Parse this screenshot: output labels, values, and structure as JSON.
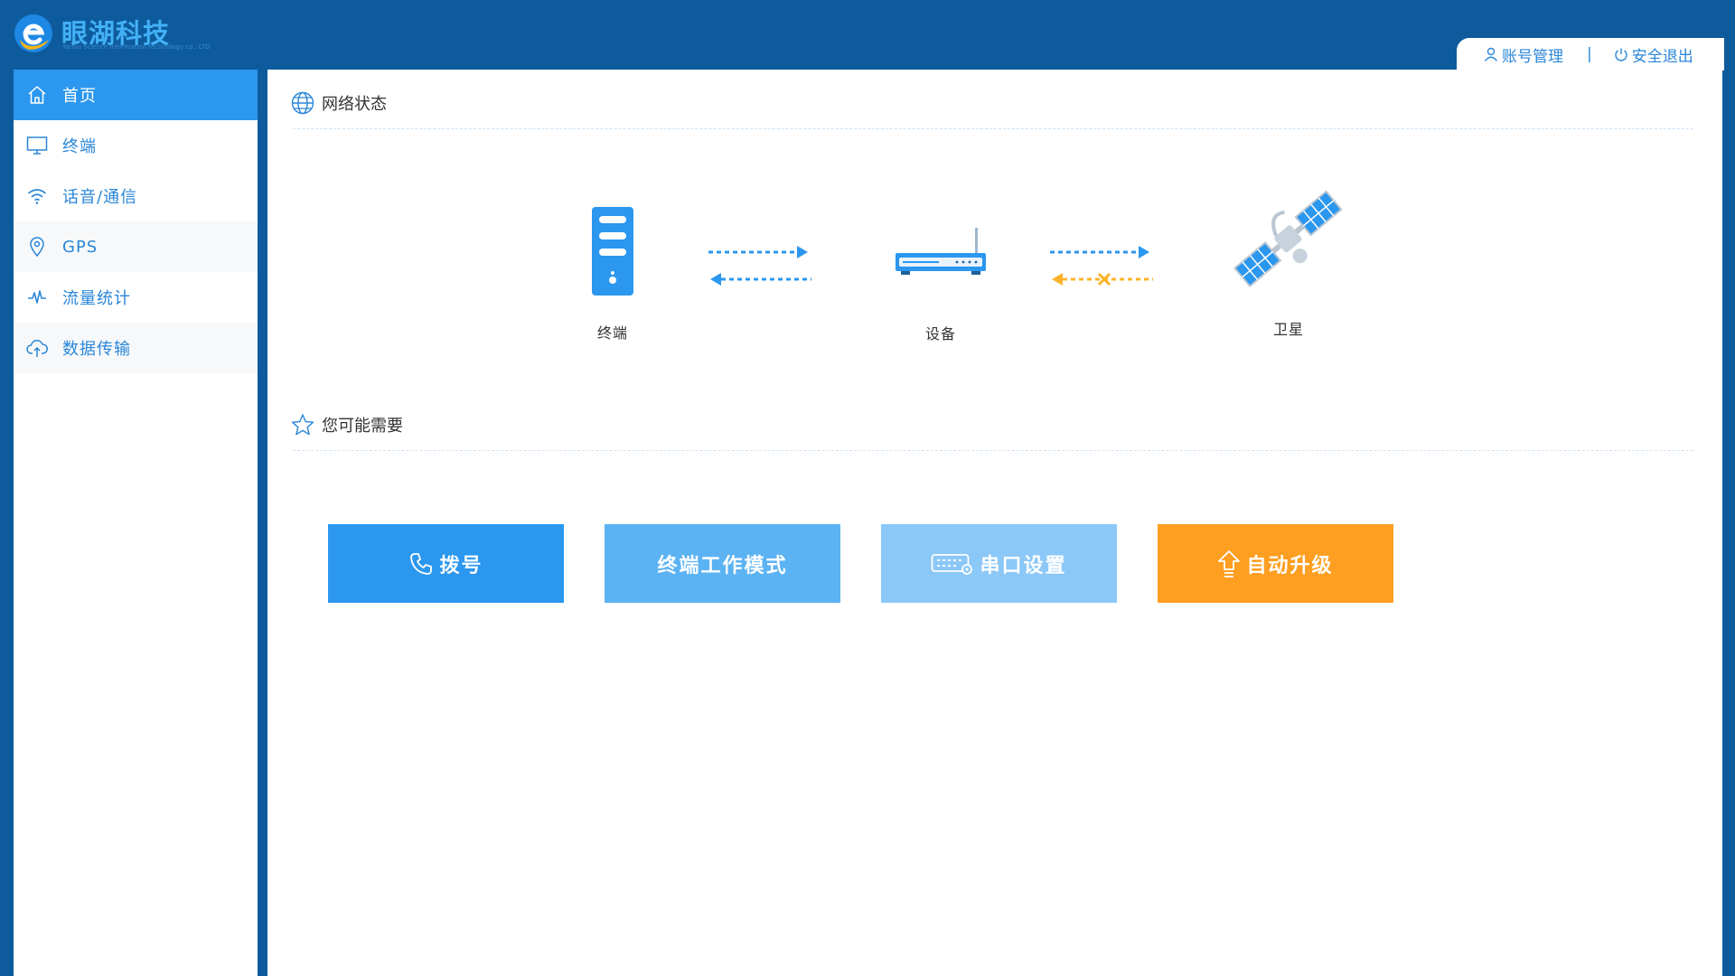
{
  "header": {
    "brand_title": "眼湖科技",
    "brand_subtitle": "Yanhu Science information technology co., LTD",
    "account_label": "账号管理",
    "separator": "|",
    "logout_label": "安全退出"
  },
  "sidebar": {
    "items": [
      {
        "label": "首页",
        "icon": "home-icon",
        "active": true
      },
      {
        "label": "终端",
        "icon": "monitor-icon"
      },
      {
        "label": "话音/通信",
        "icon": "wifi-icon"
      },
      {
        "label": "GPS",
        "icon": "location-icon"
      },
      {
        "label": "流量统计",
        "icon": "pulse-icon"
      },
      {
        "label": "数据传输",
        "icon": "cloud-upload-icon"
      }
    ]
  },
  "network": {
    "title": "网络状态",
    "nodes": [
      {
        "label": "终端",
        "icon": "server-icon"
      },
      {
        "label": "设备",
        "icon": "router-icon"
      },
      {
        "label": "卫星",
        "icon": "satellite-icon"
      }
    ],
    "links": [
      {
        "from": "终端",
        "to": "设备",
        "send": "ok",
        "receive": "ok"
      },
      {
        "from": "设备",
        "to": "卫星",
        "send": "ok",
        "receive": "failed"
      }
    ]
  },
  "suggest": {
    "title": "您可能需要",
    "buttons": [
      {
        "label": "拨号",
        "icon": "phone-icon",
        "color": "#2b97ef"
      },
      {
        "label": "终端工作模式",
        "color": "#5cb3f3"
      },
      {
        "label": "串口设置",
        "icon": "keyboard-icon",
        "color": "#8cc8f7"
      },
      {
        "label": "自动升级",
        "icon": "upload-arrow-icon",
        "color": "#fe9f22"
      }
    ]
  },
  "colors": {
    "frame": "#0d5b9d",
    "accent": "#2b97ef",
    "link_ok": "#2b97ef",
    "link_failed": "#fcb22a",
    "upgrade": "#fe9f22"
  }
}
